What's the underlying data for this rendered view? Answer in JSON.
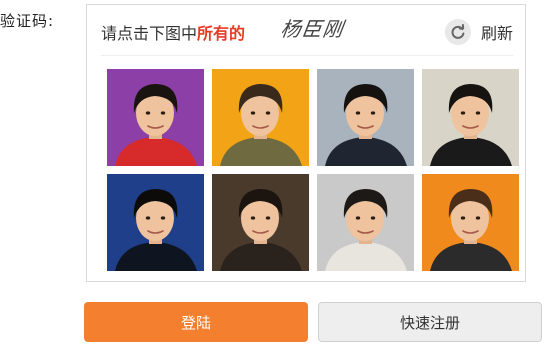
{
  "form": {
    "captcha_label": "验证码:"
  },
  "captcha": {
    "prompt_plain": "请点击下图中",
    "prompt_emphasis": "所有的",
    "target_name": "杨臣刚",
    "refresh_label": "刷新",
    "refresh_icon": "refresh-icon",
    "tiles": [
      {
        "name": "captcha-tile-1",
        "bg": "#8c3fa6",
        "shirt": "#d72a2a",
        "hair": "#1a1410"
      },
      {
        "name": "captcha-tile-2",
        "bg": "#f2a316",
        "shirt": "#6f6a3f",
        "hair": "#3a2a1c"
      },
      {
        "name": "captcha-tile-3",
        "bg": "#a9b3bd",
        "shirt": "#1f2632",
        "hair": "#15120f"
      },
      {
        "name": "captcha-tile-4",
        "bg": "#d9d4c8",
        "shirt": "#1a1a1a",
        "hair": "#161311"
      },
      {
        "name": "captcha-tile-5",
        "bg": "#1f3f8a",
        "shirt": "#0f1520",
        "hair": "#0d0b0a"
      },
      {
        "name": "captcha-tile-6",
        "bg": "#4a3a2c",
        "shirt": "#2a221c",
        "hair": "#1b140f"
      },
      {
        "name": "captcha-tile-7",
        "bg": "#c9c9c9",
        "shirt": "#e8e4de",
        "hair": "#1d1916"
      },
      {
        "name": "captcha-tile-8",
        "bg": "#f08a1c",
        "shirt": "#2b2b2b",
        "hair": "#4a2e1a"
      }
    ]
  },
  "actions": {
    "login_label": "登陆",
    "register_label": "快速注册"
  },
  "colors": {
    "accent_orange": "#f47f2e",
    "prompt_red": "#e53c27"
  }
}
